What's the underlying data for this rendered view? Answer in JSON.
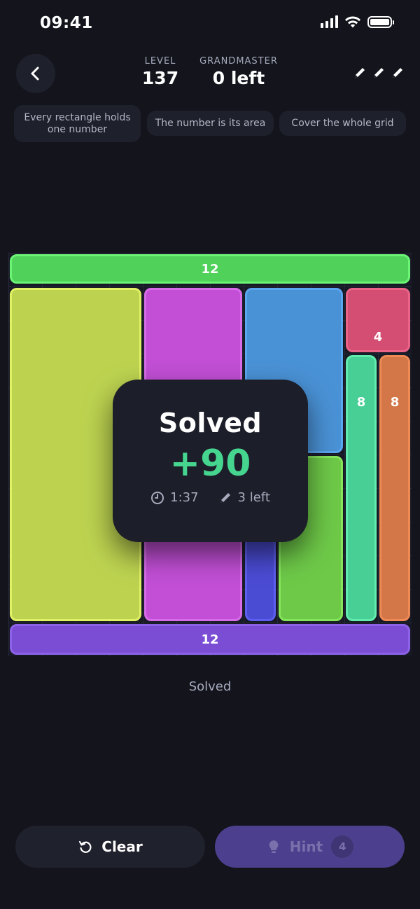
{
  "status_bar": {
    "time": "09:41"
  },
  "header": {
    "level_label": "LEVEL",
    "level_value": "137",
    "grandmaster_label": "GRANDMASTER",
    "grandmaster_value": "0 left",
    "pencils_remaining": 3
  },
  "rules": [
    "Every rectangle holds one number",
    "The number is its area",
    "Cover the whole grid"
  ],
  "board": {
    "grid_size": 12,
    "colors": {
      "top": "#4fd15a",
      "yellow": "#bdd350",
      "magenta": "#c24fd6",
      "blue": "#4a92d6",
      "indigo": "#4b4cd4",
      "green": "#6ec948",
      "red": "#d34e72",
      "teal": "#48cf95",
      "orange": "#d37748",
      "bottom": "#7a4dd4"
    },
    "clues": {
      "top": "12",
      "red": "4",
      "teal": "8",
      "orange": "8",
      "bottom": "12"
    }
  },
  "modal": {
    "title": "Solved",
    "score": "+90",
    "time": "1:37",
    "pencils_left": "3 left"
  },
  "status_text": "Solved",
  "buttons": {
    "clear_label": "Clear",
    "hint_label": "Hint",
    "hint_count": "4"
  }
}
